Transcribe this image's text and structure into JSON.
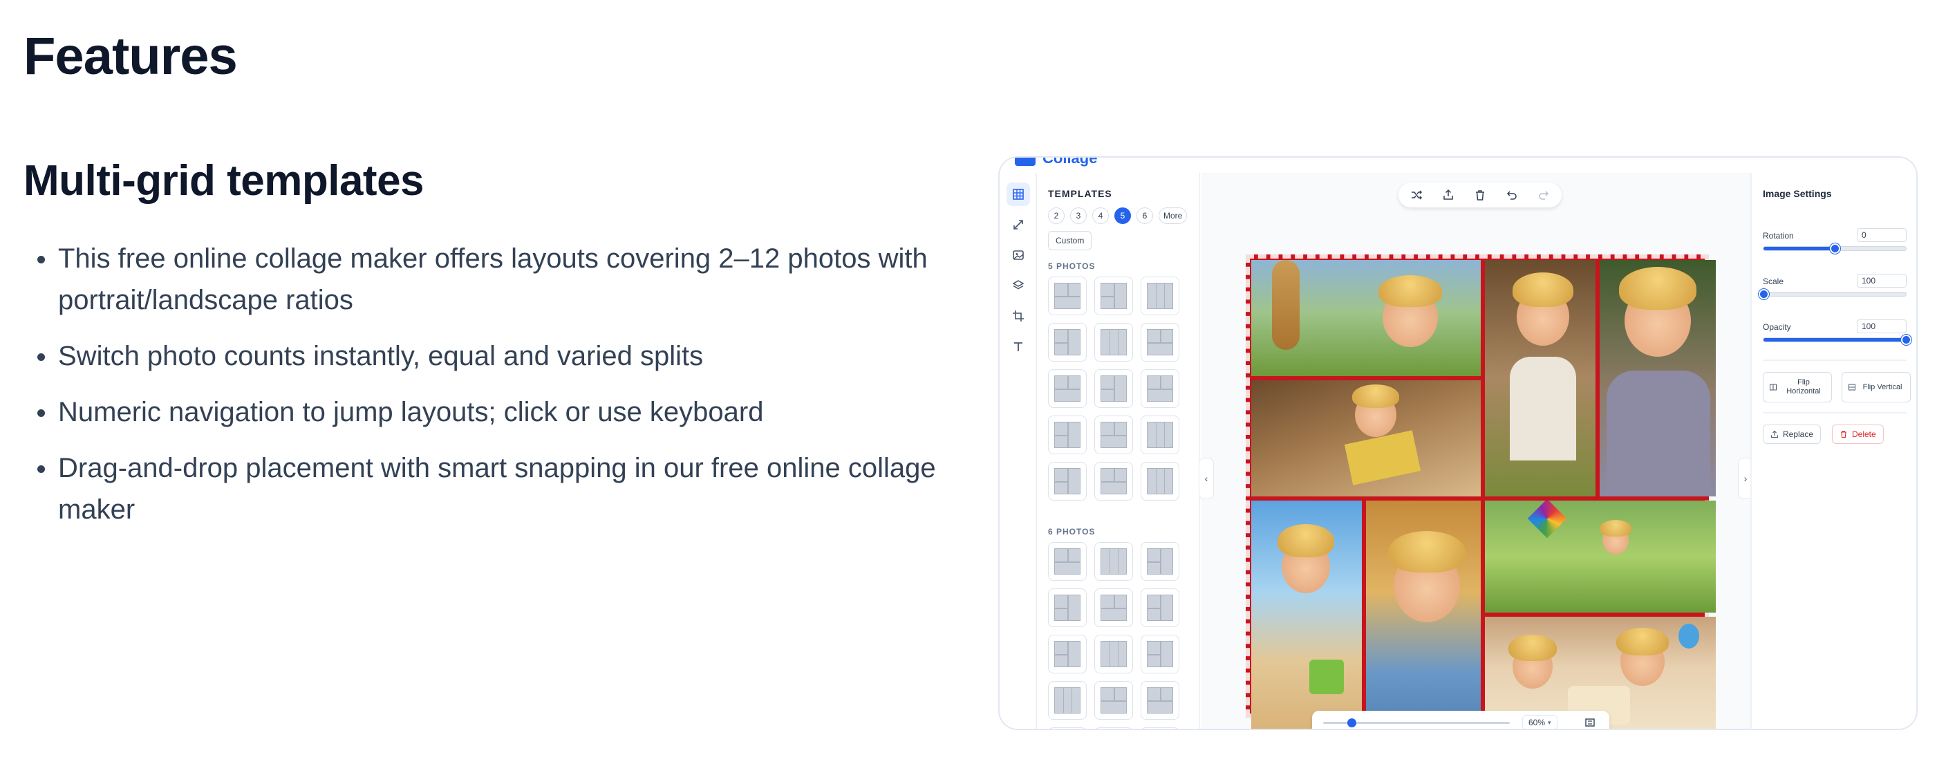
{
  "page": {
    "title": "Features",
    "section_title": "Multi-grid templates",
    "features": [
      "This free online collage maker offers layouts covering 2–12 photos with portrait/landscape ratios",
      "Switch photo counts instantly, equal and varied splits",
      "Numeric navigation to jump layouts; click or use keyboard",
      "Drag-and-drop placement with smart snapping in our free online collage maker"
    ]
  },
  "app": {
    "logo_text": "Collage",
    "accent_color": "#2563eb",
    "rail_icons": [
      "grid-icon",
      "resize-icon",
      "image-icon",
      "layers-icon",
      "crop-icon",
      "text-icon"
    ],
    "templates": {
      "heading": "TEMPLATES",
      "counts": [
        "2",
        "3",
        "4",
        "5",
        "6",
        "More"
      ],
      "selected_count": "5",
      "custom_label": "Custom",
      "group_5": "5 PHOTOS",
      "group_6": "6 PHOTOS"
    },
    "toolbar_icons": [
      "shuffle-icon",
      "export-icon",
      "trash-icon",
      "undo-icon",
      "redo-icon"
    ],
    "zoom": {
      "value_label": "60%",
      "level": 0.15
    },
    "settings": {
      "title": "Image Settings",
      "rotation_label": "Rotation",
      "rotation_value": "0",
      "rotation_level": 0.5,
      "scale_label": "Scale",
      "scale_value": "100",
      "scale_level": 0.0,
      "opacity_label": "Opacity",
      "opacity_value": "100",
      "opacity_level": 1.0,
      "flip_horizontal": "Flip Horizontal",
      "flip_vertical": "Flip Vertical",
      "replace": "Replace",
      "delete": "Delete"
    },
    "collage_border_color": "#c8141d"
  }
}
